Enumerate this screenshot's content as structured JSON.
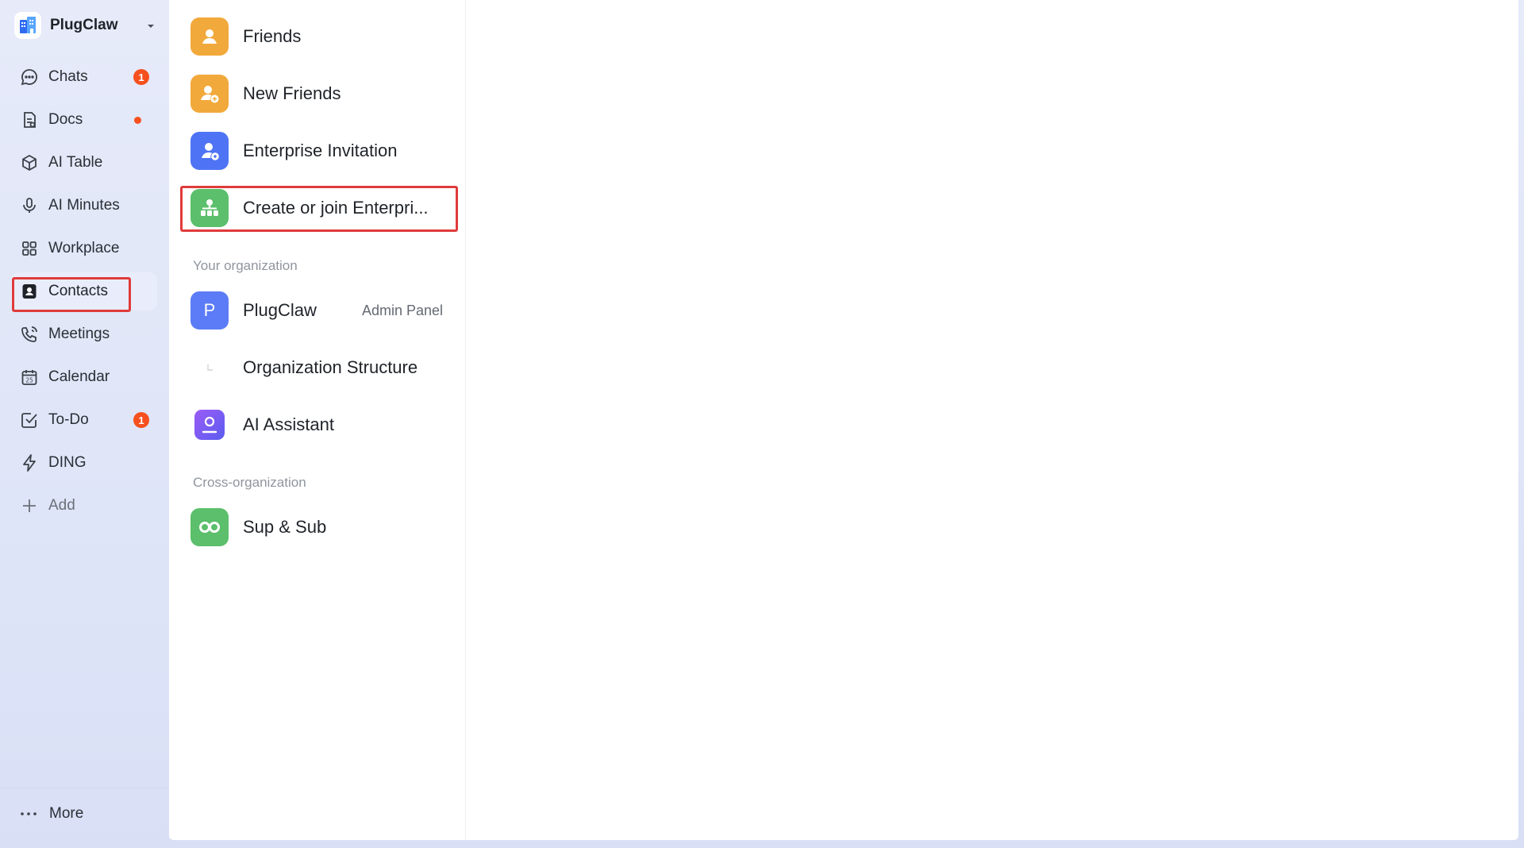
{
  "org": {
    "name": "PlugClaw"
  },
  "sidebar": {
    "items": [
      {
        "label": "Chats",
        "badge": "1"
      },
      {
        "label": "Docs"
      },
      {
        "label": "AI Table"
      },
      {
        "label": "AI Minutes"
      },
      {
        "label": "Workplace"
      },
      {
        "label": "Contacts",
        "active": true
      },
      {
        "label": "Meetings"
      },
      {
        "label": "Calendar",
        "icon_text": "25"
      },
      {
        "label": "To-Do",
        "badge": "1"
      },
      {
        "label": "DING"
      },
      {
        "label": "Add"
      }
    ],
    "more_label": "More"
  },
  "contacts": {
    "top_items": [
      {
        "label": "Friends",
        "icon": "person-icon",
        "color": "#f2a93b"
      },
      {
        "label": "New Friends",
        "icon": "person-add-icon",
        "color": "#f2a93b"
      },
      {
        "label": "Enterprise Invitation",
        "icon": "person-invite-icon",
        "color": "#4e74f5"
      },
      {
        "label": "Create or join Enterpri...",
        "icon": "org-people-icon",
        "color": "#5cbf6b"
      }
    ],
    "your_org_label": "Your organization",
    "org": {
      "name": "PlugClaw",
      "avatar_letter": "P",
      "admin_label": "Admin Panel",
      "color": "#5b7cf6"
    },
    "org_structure_label": "Organization Structure",
    "ai_assistant_label": "AI Assistant",
    "cross_org_label": "Cross-organization",
    "sup_sub_label": "Sup & Sub"
  },
  "colors": {
    "accent_blue": "#4e74f5",
    "badge_red": "#f5501e",
    "highlight_red": "#e03b3b"
  }
}
